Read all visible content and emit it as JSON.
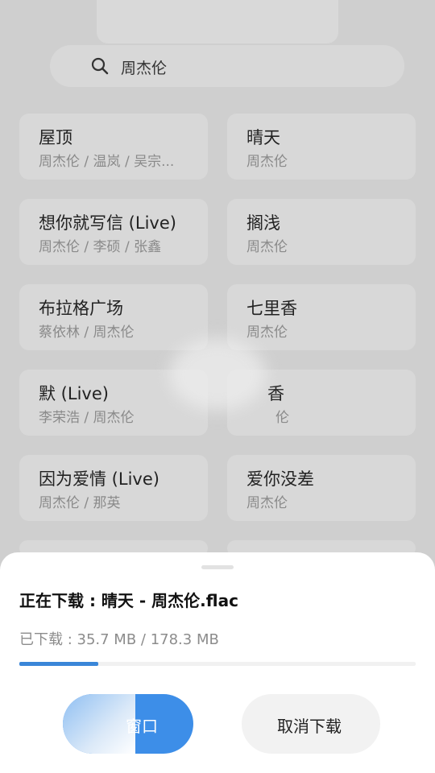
{
  "search": {
    "query": "周杰伦"
  },
  "songs": [
    {
      "title": "屋顶",
      "artist": "周杰伦 / 温岚 / 吴宗..."
    },
    {
      "title": "晴天",
      "artist": "周杰伦"
    },
    {
      "title": "想你就写信 (Live)",
      "artist": "周杰伦 / 李硕 / 张鑫"
    },
    {
      "title": "搁浅",
      "artist": "周杰伦"
    },
    {
      "title": "布拉格广场",
      "artist": "蔡依林 / 周杰伦"
    },
    {
      "title": "七里香",
      "artist": "周杰伦"
    },
    {
      "title": "默 (Live)",
      "artist": "李荣浩 / 周杰伦"
    },
    {
      "title": "香",
      "artist": "伦"
    },
    {
      "title": "因为爱情 (Live)",
      "artist": "周杰伦 / 那英"
    },
    {
      "title": "爱你没差",
      "artist": "周杰伦"
    }
  ],
  "download": {
    "title": "正在下载 : 晴天 - 周杰伦.flac",
    "size_text": "已下载 : 35.7 MB / 178.3 MB",
    "progress": 0.2,
    "primary_button_label": "窗口",
    "cancel_button_label": "取消下载"
  },
  "colors": {
    "accent": "#3d8ee8",
    "progress": "#3a86d8"
  }
}
